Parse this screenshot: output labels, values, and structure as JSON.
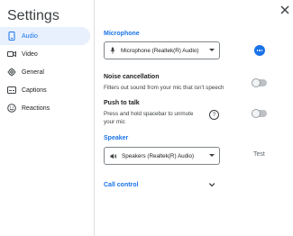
{
  "window": {
    "title": "Settings"
  },
  "sidebar": {
    "items": [
      {
        "label": "Audio",
        "icon": "phone-audio-icon",
        "active": true
      },
      {
        "label": "Video",
        "icon": "camera-icon",
        "active": false
      },
      {
        "label": "General",
        "icon": "gear-icon",
        "active": false
      },
      {
        "label": "Captions",
        "icon": "captions-icon",
        "active": false
      },
      {
        "label": "Reactions",
        "icon": "smiley-icon",
        "active": false
      }
    ]
  },
  "audio": {
    "microphone": {
      "section_title": "Microphone",
      "selected": "Microphone (Realtek(R) Audio)"
    },
    "noise": {
      "title": "Noise cancellation",
      "description": "Filters out sound from your mic that isn't speech",
      "enabled": false
    },
    "push": {
      "title": "Push to talk",
      "description": "Press and hold spacebar to unmute your mic",
      "help_glyph": "?",
      "enabled": false
    },
    "speaker": {
      "section_title": "Speaker",
      "selected": "Speakers (Realtek(R) Audio)",
      "test_label": "Test"
    },
    "call_control": {
      "section_title": "Call control"
    }
  },
  "colors": {
    "accent": "#1a73e8",
    "active_bg": "#e8f0fe"
  }
}
